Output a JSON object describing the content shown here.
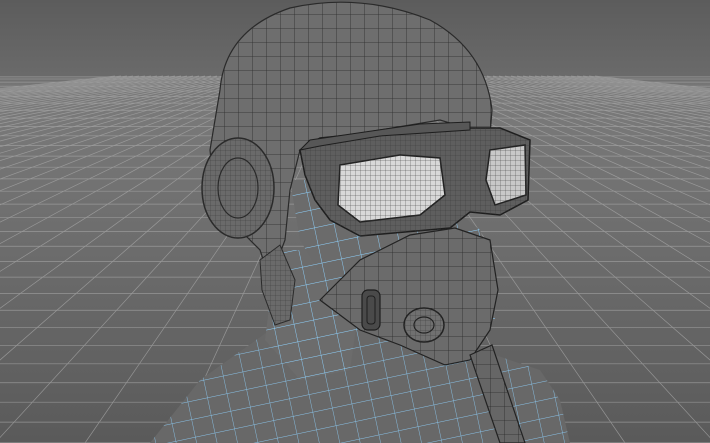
{
  "viewport": {
    "background_color": "#5f5f5f",
    "horizon_color": "#7b7b7b",
    "grid_color": "#a6a6a6",
    "mesh_fill_color": "#6e6e6e",
    "mesh_wire_color": "#2a2a2a",
    "selection_wire_color": "#8fd3ff",
    "lens_color": "#d8d8d8"
  },
  "scene": {
    "objects": [
      "grid-floor",
      "torso",
      "neck",
      "head",
      "helmet",
      "ear-cup",
      "goggles",
      "gas-mask",
      "respirator-valve",
      "breathing-hose"
    ]
  }
}
